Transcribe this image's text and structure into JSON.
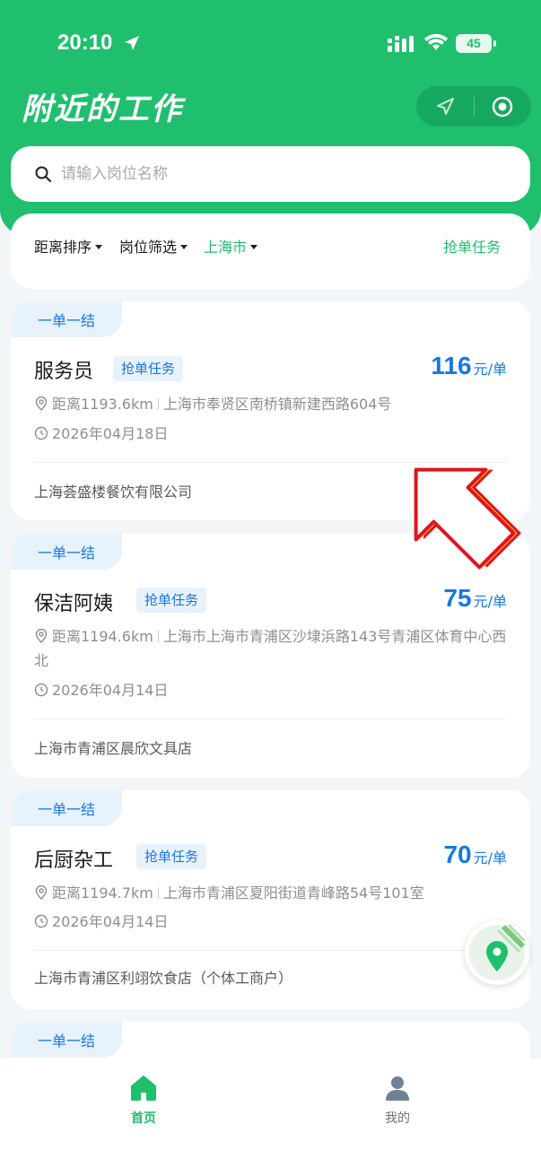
{
  "status_bar": {
    "time": "20:10",
    "battery": "45"
  },
  "header": {
    "title": "附近的工作"
  },
  "search": {
    "placeholder": "请输入岗位名称"
  },
  "filters": {
    "distance_sort": "距离排序",
    "job_filter": "岗位筛选",
    "city": "上海市",
    "grab_task": "抢单任务"
  },
  "jobs": [
    {
      "settlement": "一单一结",
      "title": "服务员",
      "tag": "抢单任务",
      "price": "116",
      "unit": "元/单",
      "distance": "距离1193.6km",
      "address": "上海市奉贤区南桥镇新建西路604号",
      "date": "2026年04月18日",
      "company": "上海荟盛楼餐饮有限公司"
    },
    {
      "settlement": "一单一结",
      "title": "保洁阿姨",
      "tag": "抢单任务",
      "price": "75",
      "unit": "元/单",
      "distance": "距离1194.6km",
      "address": "上海市上海市青浦区沙埭浜路143号青浦区体育中心西北",
      "date": "2026年04月14日",
      "company": "上海市青浦区晨欣文具店"
    },
    {
      "settlement": "一单一结",
      "title": "后厨杂工",
      "tag": "抢单任务",
      "price": "70",
      "unit": "元/单",
      "distance": "距离1194.7km",
      "address": "上海市青浦区夏阳街道青峰路54号101室",
      "date": "2026年04月14日",
      "company": "上海市青浦区利翊饮食店（个体工商户）"
    },
    {
      "settlement": "一单一结"
    }
  ],
  "tabbar": {
    "home": "首页",
    "mine": "我的"
  },
  "colors": {
    "brand_green": "#1fbf6e",
    "accent_blue": "#1677e6",
    "arrow_red": "#e0141e",
    "arrow_yellow": "#ffc62b"
  },
  "icons": [
    "location-arrow-icon",
    "signal-icon",
    "wifi-icon",
    "navigation-icon",
    "target-icon",
    "search-icon",
    "pin-icon",
    "clock-icon",
    "map-pin-icon",
    "home-icon",
    "user-icon",
    "pointer-arrow-icon"
  ]
}
